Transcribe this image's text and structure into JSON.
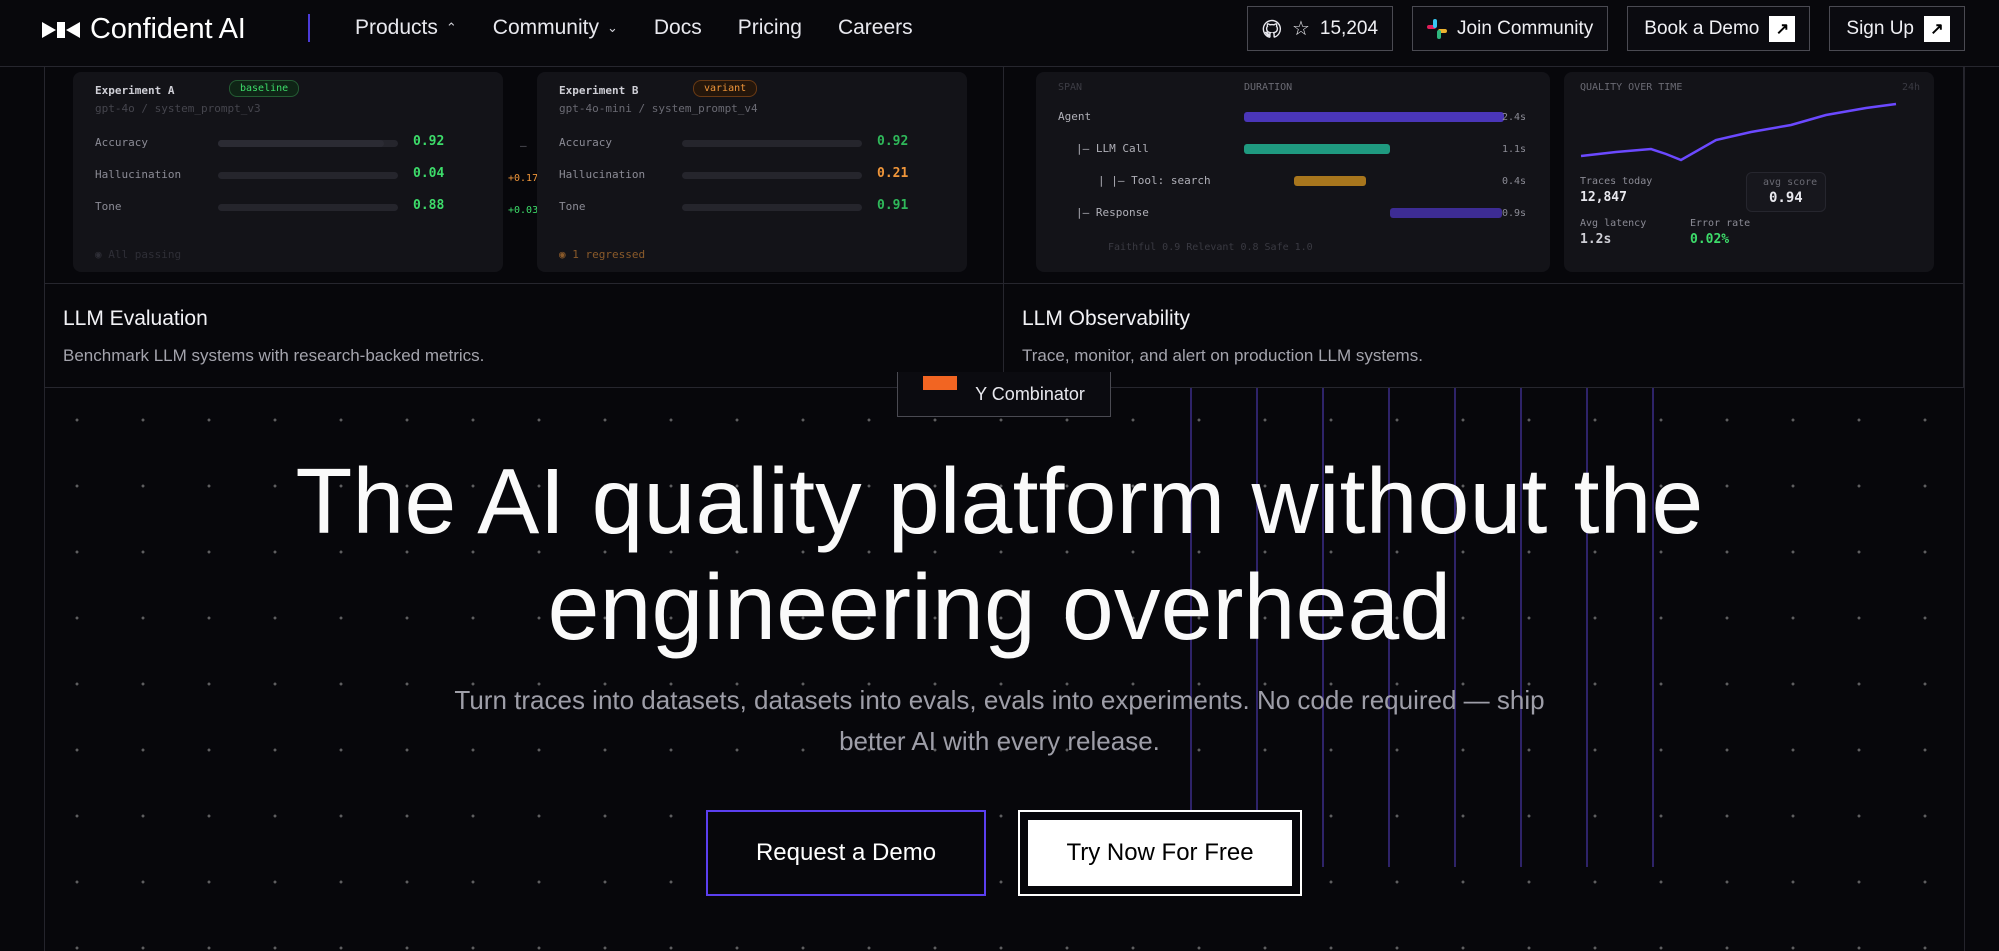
{
  "nav": {
    "brand": "Confident AI",
    "links": [
      {
        "label": "Products",
        "chevron": "^"
      },
      {
        "label": "Community",
        "chevron": "v"
      },
      {
        "label": "Docs"
      },
      {
        "label": "Pricing"
      },
      {
        "label": "Careers"
      }
    ],
    "github_stars": "15,204",
    "join_community": "Join Community",
    "book_demo": "Book a Demo",
    "sign_up": "Sign Up"
  },
  "cards": {
    "evaluation": {
      "title": "LLM Evaluation",
      "subtitle": "Benchmark LLM systems with research-backed metrics.",
      "exp_a": {
        "name": "Experiment A",
        "tag": "baseline",
        "model": "gpt-4o / system_prompt_v3",
        "status": "All passing"
      },
      "exp_b": {
        "name": "Experiment B",
        "tag": "variant",
        "model": "gpt-4o-mini / system_prompt_v4",
        "status": "1 regressed"
      },
      "metrics": [
        {
          "name": "Accuracy",
          "a": "0.92",
          "delta": "—",
          "b": "0.92"
        },
        {
          "name": "Hallucination",
          "a": "0.04",
          "delta": "+0.17",
          "b": "0.21"
        },
        {
          "name": "Tone",
          "a": "0.88",
          "delta": "+0.03",
          "b": "0.91"
        }
      ]
    },
    "observability": {
      "title": "LLM Observability",
      "subtitle": "Trace, monitor, and alert on production LLM systems.",
      "span_header": "SPAN",
      "duration_header": "DURATION",
      "spans": [
        {
          "name": "Agent",
          "duration": "2.4s"
        },
        {
          "name": "|— LLM Call",
          "duration": "1.1s"
        },
        {
          "name": "| |— Tool: search",
          "duration": "0.4s"
        },
        {
          "name": "|— Response",
          "duration": "0.9s"
        }
      ],
      "scores": "Faithful 0.9  Relevant 0.8  Safe 1.0",
      "quality_title": "QUALITY OVER TIME",
      "quality_range": "24h",
      "traces_label": "Traces today",
      "traces_value": "12,847",
      "avg_score_label": "avg score",
      "avg_score_value": "0.94",
      "latency_label": "Avg latency",
      "latency_value": "1.2s",
      "error_label": "Error rate",
      "error_value": "0.02%"
    }
  },
  "hero": {
    "badge": "Y Combinator",
    "headline_1": "The AI quality platform without the",
    "headline_2": "engineering overhead",
    "subline_1": "Turn traces into datasets, datasets into evals, evals into experiments. No code required — ship",
    "subline_2": "better AI with every release.",
    "cta_primary": "Request a Demo",
    "cta_secondary": "Try Now For Free"
  },
  "colors": {
    "accent": "#5b3ff0",
    "yc_orange": "#f26522",
    "good_green": "#3ddc6a",
    "warn_orange": "#f0963a"
  }
}
